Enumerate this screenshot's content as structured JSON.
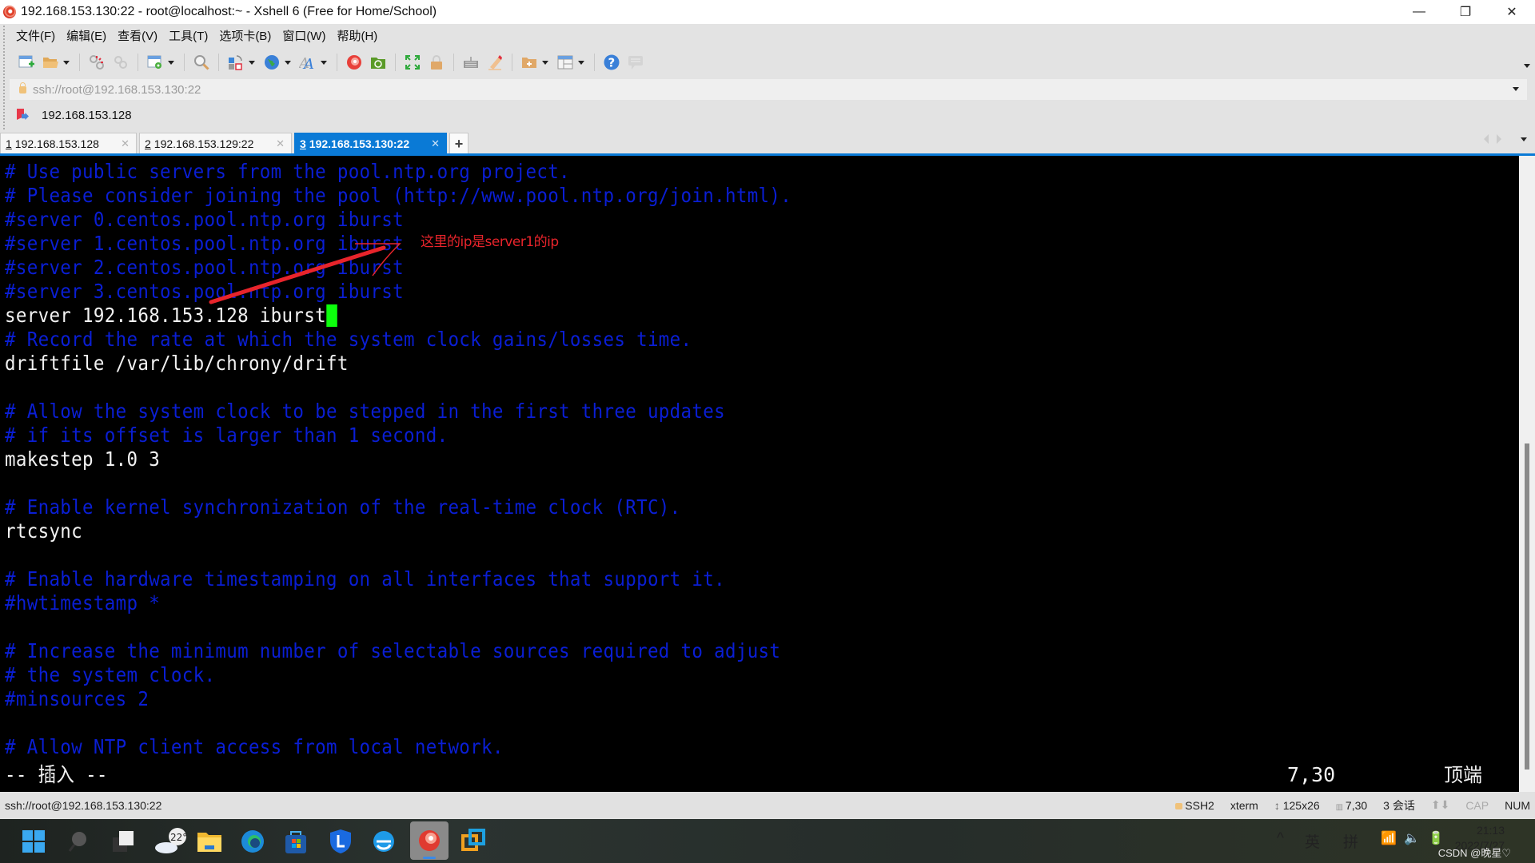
{
  "window": {
    "title": "192.168.153.130:22 - root@localhost:~ - Xshell 6 (Free for Home/School)",
    "controls": {
      "minimize": "—",
      "restore": "❐",
      "close": "✕"
    }
  },
  "menu": [
    "文件(F)",
    "编辑(E)",
    "查看(V)",
    "工具(T)",
    "选项卡(B)",
    "窗口(W)",
    "帮助(H)"
  ],
  "toolbar": {
    "icons": [
      "new-session-icon",
      "open-folder-icon",
      "disconnect-icon",
      "reconnect-icon",
      "session-properties-icon",
      "find-icon",
      "transfer-icon",
      "globe-icon",
      "font-icon",
      "xshell-icon",
      "xftp-icon",
      "fullscreen-icon",
      "lock-icon",
      "keyboard-icon",
      "highlight-icon",
      "new-folder-icon",
      "layout-icon",
      "help-icon",
      "chat-icon"
    ]
  },
  "address": {
    "value": "ssh://root@192.168.153.130:22"
  },
  "quick_bar": {
    "label": "192.168.153.128"
  },
  "tabs": [
    {
      "num": "1",
      "label": "192.168.153.128",
      "active": false
    },
    {
      "num": "2",
      "label": "192.168.153.129:22",
      "active": false
    },
    {
      "num": "3",
      "label": "192.168.153.130:22",
      "active": true
    }
  ],
  "tab_add": "+",
  "terminal": {
    "lines": [
      {
        "text": "# Use public servers from the pool.ntp.org project.",
        "type": "comment"
      },
      {
        "text": "# Please consider joining the pool (http://www.pool.ntp.org/join.html).",
        "type": "comment"
      },
      {
        "text": "#server 0.centos.pool.ntp.org iburst",
        "type": "comment"
      },
      {
        "text": "#server 1.centos.pool.ntp.org iburst",
        "type": "comment"
      },
      {
        "text": "#server 2.centos.pool.ntp.org iburst",
        "type": "comment"
      },
      {
        "text": "#server 3.centos.pool.ntp.org iburst",
        "type": "comment"
      },
      {
        "text": "server 192.168.153.128 iburst",
        "type": "text",
        "cursor": true
      },
      {
        "text": "# Record the rate at which the system clock gains/losses time.",
        "type": "comment"
      },
      {
        "text": "driftfile /var/lib/chrony/drift",
        "type": "text"
      },
      {
        "text": "",
        "type": "text"
      },
      {
        "text": "# Allow the system clock to be stepped in the first three updates",
        "type": "comment"
      },
      {
        "text": "# if its offset is larger than 1 second.",
        "type": "comment"
      },
      {
        "text": "makestep 1.0 3",
        "type": "text"
      },
      {
        "text": "",
        "type": "text"
      },
      {
        "text": "# Enable kernel synchronization of the real-time clock (RTC).",
        "type": "comment"
      },
      {
        "text": "rtcsync",
        "type": "text"
      },
      {
        "text": "",
        "type": "text"
      },
      {
        "text": "# Enable hardware timestamping on all interfaces that support it.",
        "type": "comment"
      },
      {
        "text": "#hwtimestamp *",
        "type": "comment"
      },
      {
        "text": "",
        "type": "text"
      },
      {
        "text": "# Increase the minimum number of selectable sources required to adjust",
        "type": "comment"
      },
      {
        "text": "# the system clock.",
        "type": "comment"
      },
      {
        "text": "#minsources 2",
        "type": "comment"
      },
      {
        "text": "",
        "type": "text"
      },
      {
        "text": "# Allow NTP client access from local network.",
        "type": "comment"
      }
    ],
    "mode_line": "-- 插入 --",
    "cursor_pos": "7,30",
    "scroll_pos": "顶端",
    "annotation": "这里的ip是server1的ip",
    "colors": {
      "comment": "#0a1ed4",
      "text": "#f2f2f2",
      "cursor": "#0cff0c",
      "annotation": "#e8242b"
    }
  },
  "status_bar": {
    "connection": "ssh://root@192.168.153.130:22",
    "protocol": "SSH2",
    "terminal_type": "xterm",
    "size": "125x26",
    "cursor": "7,30",
    "sessions": "3 会话",
    "cap": "CAP",
    "num": "NUM"
  },
  "taskbar": {
    "weather": "22°",
    "apps": [
      "start-icon",
      "search-icon",
      "task-view-icon",
      "weather-icon",
      "file-explorer-icon",
      "edge-icon",
      "store-icon",
      "lenovo-icon",
      "ie-icon",
      "xshell-icon",
      "vmware-icon"
    ],
    "tray": {
      "chevron": "^",
      "lang1": "英",
      "lang2": "拼"
    },
    "time": "21:13",
    "date": "2022/7/27",
    "watermark": "CSDN @晚星♡"
  }
}
